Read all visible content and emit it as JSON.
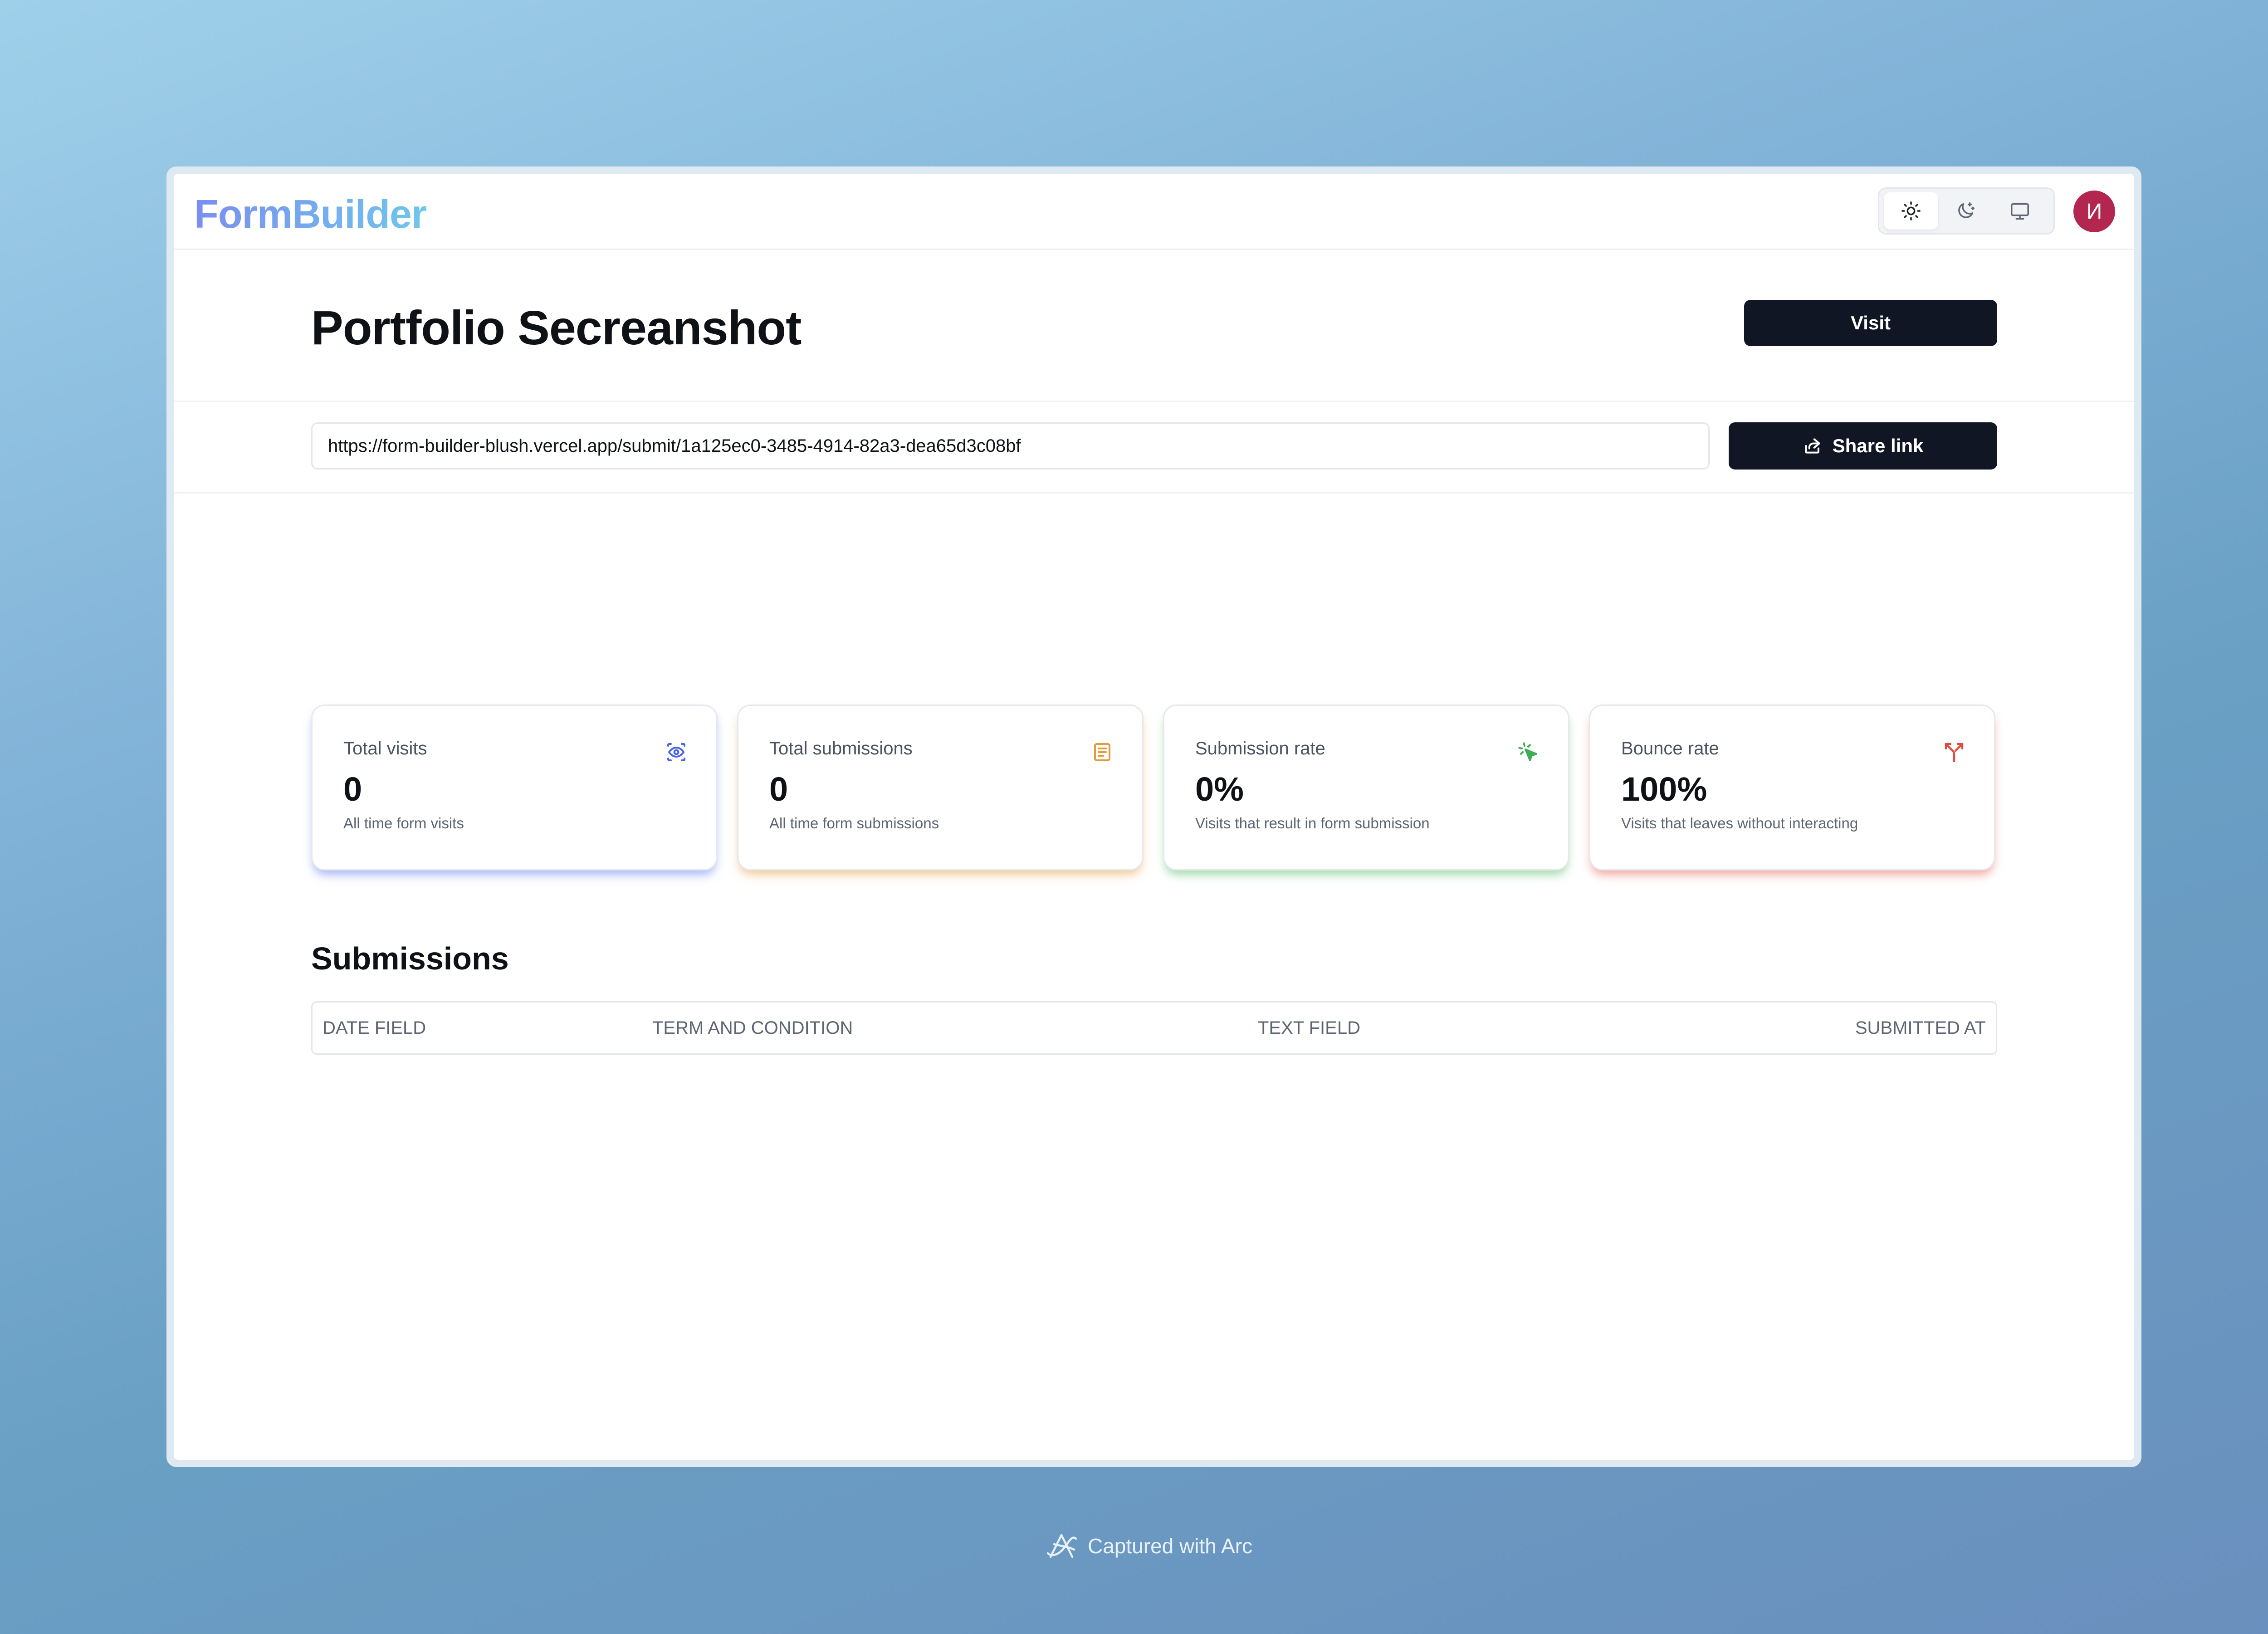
{
  "app": {
    "logo": "FormBuilder",
    "avatar_initial": "И",
    "theme_modes": [
      "light",
      "dark",
      "system"
    ],
    "active_theme": "light"
  },
  "header": {
    "title": "Portfolio Secreanshot",
    "visit_label": "Visit"
  },
  "share": {
    "url": "https://form-builder-blush.vercel.app/submit/1a125ec0-3485-4914-82a3-dea65d3c08bf",
    "button_label": "Share link"
  },
  "stats": [
    {
      "title": "Total visits",
      "value": "0",
      "description": "All time form visits",
      "icon": "eye-icon",
      "accent": "#5a6ff0"
    },
    {
      "title": "Total submissions",
      "value": "0",
      "description": "All time form submissions",
      "icon": "document-icon",
      "accent": "#e39a3a"
    },
    {
      "title": "Submission rate",
      "value": "0%",
      "description": "Visits that result in form submission",
      "icon": "cursor-click-icon",
      "accent": "#3fae55"
    },
    {
      "title": "Bounce rate",
      "value": "100%",
      "description": "Visits that leaves without interacting",
      "icon": "split-arrow-icon",
      "accent": "#e24a3e"
    }
  ],
  "submissions": {
    "title": "Submissions",
    "columns": [
      "Date Field",
      "Term and condition",
      "Text Field",
      "Submitted at"
    ]
  },
  "footer": {
    "label": "Captured with Arc"
  }
}
